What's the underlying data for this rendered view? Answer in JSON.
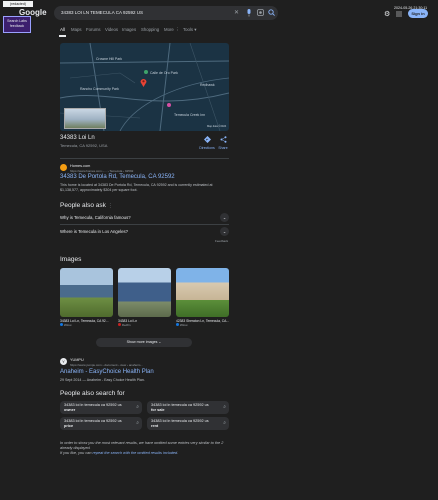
{
  "topbar": {
    "watermark": "(redacted)",
    "feedback": "Search Labs\nfeedback",
    "logo": "Google",
    "search_value": "34383 LOI LN TEMECULA CA 92592 US",
    "datetime": "2024-05-26 21:30:11",
    "signin": "Sign in"
  },
  "tabs": [
    "All",
    "Maps",
    "Forums",
    "Videos",
    "Images",
    "Shopping",
    "More",
    "Tools"
  ],
  "map": {
    "labels": [
      "Crowne Hill Park",
      "Calle de Oro Park",
      "Rancho Community Park",
      "Temecula Creek Inn",
      "Redhawk",
      "Map data ©2024"
    ],
    "address_title": "34383 Loi Ln",
    "address_sub": "Temecula, CA 92592, USA",
    "directions": "Directions",
    "share": "Share"
  },
  "result1": {
    "site": "Homes.com",
    "url": "https://www.homes.com › ... › Temecula › 92592",
    "title": "34383 De Portola Rd, Temecula, CA 92592",
    "snippet": "This home is located at 34383 De Portola Rd, Temecula, CA 92592 and is currently estimated at $1,138,577, approximately $304 per square foot."
  },
  "paa": {
    "heading": "People also ask",
    "questions": [
      "Why is Temecula, California famous?",
      "Where is Temecula in Los Angeles?"
    ],
    "feedback": "Feedback"
  },
  "images": {
    "heading": "Images",
    "items": [
      {
        "caption": "34383 Loi Ln, Temecula, CA 92...",
        "source": "Zillow"
      },
      {
        "caption": "34383 Loi Ln",
        "source": "Redfin"
      },
      {
        "caption": "42383 Sheraton Ln, Temecula, CA...",
        "source": "Zillow"
      }
    ],
    "show_more": "Show more images"
  },
  "result2": {
    "site": "YUMPU",
    "url": "https://www.yumpu.com › document › view › anaheim...",
    "title": "Anaheim - EasyChoice Health Plan",
    "snippet": "29 Sept 2014 — Anaheim - Easy Choice Health Plan."
  },
  "pase": {
    "heading": "People also search for",
    "items": [
      {
        "l1": "34383 loi ln temecula ca 92592 us",
        "l2": "owner"
      },
      {
        "l1": "34383 loi ln temecula ca 92592 us",
        "l2": "for sale"
      },
      {
        "l1": "34383 loi ln temecula ca 92592 us",
        "l2": "price"
      },
      {
        "l1": "34383 loi ln temecula ca 92592 us",
        "l2": "rent"
      }
    ]
  },
  "omitted": {
    "line1": "In order to show you the most relevant results, we have omitted some entries very similar to the 2 already displayed.",
    "line2_prefix": "If you like, you can ",
    "link": "repeat the search with the omitted results included",
    "line2_suffix": "."
  },
  "colors": {
    "accent": "#8ab4f8",
    "bg": "#1f1f1f",
    "signin_bg": "#8ab4f8"
  }
}
